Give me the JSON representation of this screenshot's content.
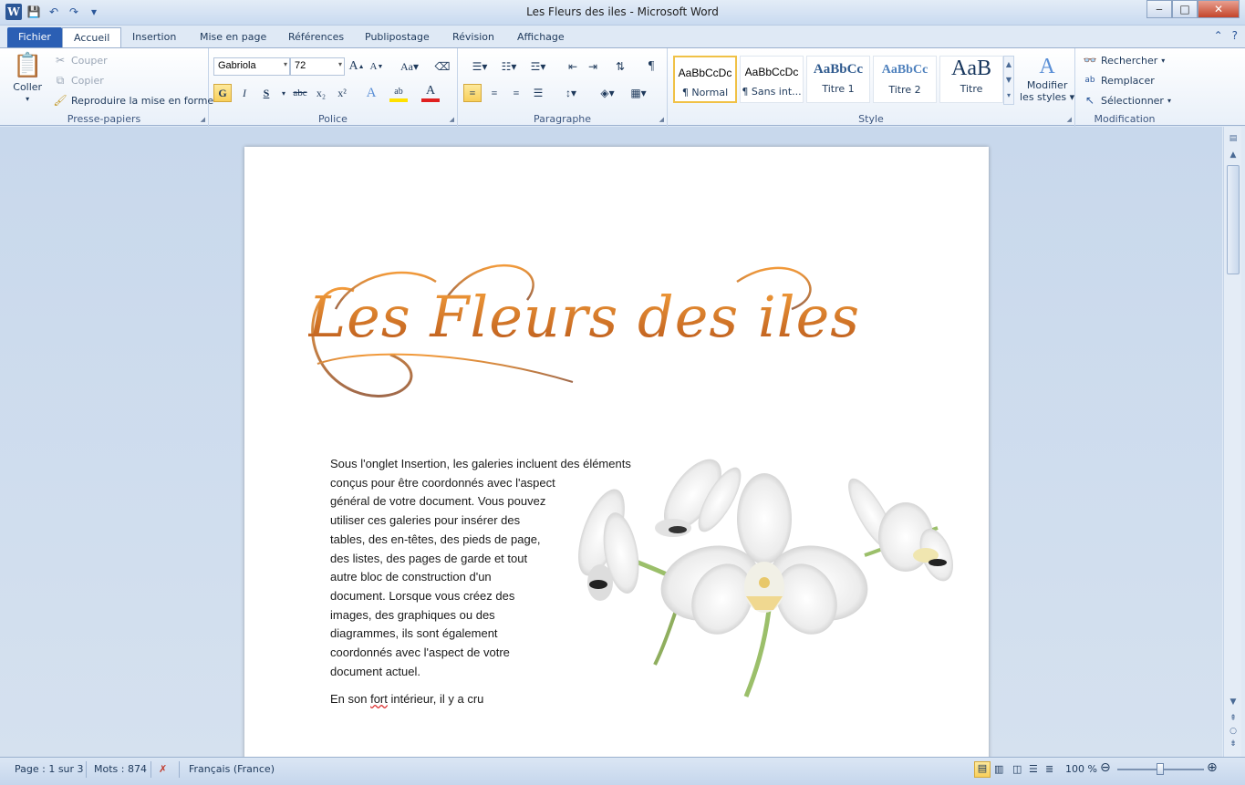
{
  "window": {
    "title": "Les Fleurs des iles  -  Microsoft Word",
    "app_icon_letter": "W"
  },
  "tabs": [
    {
      "label": "Fichier"
    },
    {
      "label": "Accueil"
    },
    {
      "label": "Insertion"
    },
    {
      "label": "Mise en page"
    },
    {
      "label": "Références"
    },
    {
      "label": "Publipostage"
    },
    {
      "label": "Révision"
    },
    {
      "label": "Affichage"
    }
  ],
  "clipboard": {
    "paste": "Coller",
    "cut": "Couper",
    "copy": "Copier",
    "format_painter": "Reproduire la mise en forme",
    "group": "Presse-papiers"
  },
  "font": {
    "name": "Gabriola",
    "size": "72",
    "group": "Police",
    "bold": "G",
    "italic": "I",
    "underline": "S",
    "strike": "abc",
    "sub": "x₂",
    "sup": "x²",
    "grow": "A",
    "shrink": "A",
    "case": "Aa",
    "color_letter": "A",
    "highlight": "ab"
  },
  "paragraph": {
    "group": "Paragraphe",
    "pilcrow": "¶"
  },
  "styles": {
    "group": "Style",
    "items": [
      {
        "sample": "AaBbCcDc",
        "name": "¶ Normal"
      },
      {
        "sample": "AaBbCcDc",
        "name": "¶ Sans int..."
      },
      {
        "sample": "AaBbCc",
        "name": "Titre 1"
      },
      {
        "sample": "AaBbCc",
        "name": "Titre 2"
      },
      {
        "sample": "AaB",
        "name": "Titre"
      }
    ],
    "modify_line1": "Modifier",
    "modify_line2": "les styles"
  },
  "editing": {
    "group": "Modification",
    "find": "Rechercher",
    "replace": "Remplacer",
    "select": "Sélectionner"
  },
  "document": {
    "title": "Les Fleurs des iles",
    "body_lines": [
      "Sous l'onglet Insertion, les galeries incluent des éléments",
      "conçus pour être coordonnés avec l'aspect",
      "général de votre document. Vous pouvez",
      "utiliser ces galeries pour insérer des",
      "tables, des en-têtes, des pieds de page,",
      "des listes, des pages de garde et tout",
      "autre bloc de construction d'un",
      "document. Lorsque vous créez des",
      "images, des graphiques ou des",
      "diagrammes, ils sont également",
      "coordonnés avec l'aspect de votre",
      "document actuel."
    ],
    "line2_before": "En son ",
    "line2_misspelled": "fort",
    "line2_after": " intérieur, il y a cru"
  },
  "statusbar": {
    "page": "Page : 1 sur 3",
    "words": "Mots : 874",
    "language": "Français (France)",
    "zoom": "100 %",
    "zoom_level_percent": 100
  },
  "colors": {
    "accent": "#2b5fb4",
    "title_orange": "#d97618"
  }
}
